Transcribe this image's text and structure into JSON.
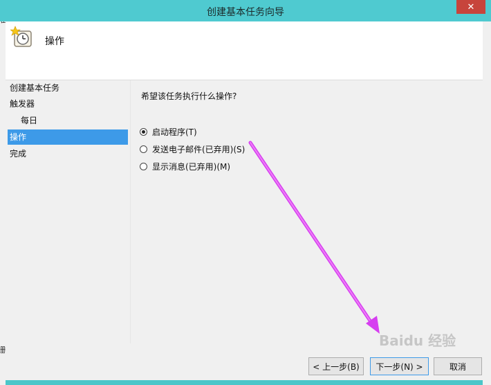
{
  "window": {
    "title": "创建基本任务向导",
    "close_label": "✕"
  },
  "background": {
    "left_chars": [
      "完",
      "备"
    ],
    "left_bottom_char": "删"
  },
  "header": {
    "title": "操作"
  },
  "sidebar": {
    "items": [
      {
        "label": "创建基本任务"
      },
      {
        "label": "触发器"
      },
      {
        "label": "每日"
      },
      {
        "label": "操作"
      },
      {
        "label": "完成"
      }
    ]
  },
  "main": {
    "question": "希望该任务执行什么操作?",
    "options": [
      {
        "label": "启动程序(T)",
        "selected": true
      },
      {
        "label": "发送电子邮件(已弃用)(S)",
        "selected": false
      },
      {
        "label": "显示消息(已弃用)(M)",
        "selected": false
      }
    ]
  },
  "buttons": {
    "back": "< 上一步(B)",
    "next": "下一步(N) >",
    "cancel": "取消"
  },
  "watermark": {
    "text": "Baidu 经验"
  },
  "colors": {
    "title_bar": "#4fcad0",
    "active_item": "#3d9ae8",
    "annotation_arrow": "#d63ef0"
  }
}
